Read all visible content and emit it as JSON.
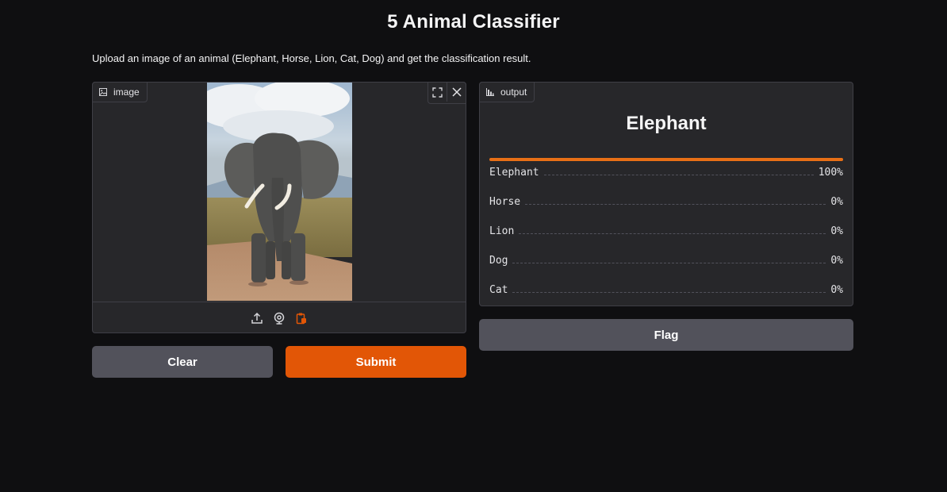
{
  "app": {
    "title": "5 Animal Classifier",
    "description": "Upload an image of an animal (Elephant, Horse, Lion, Cat, Dog) and get the classification result."
  },
  "input": {
    "label": "image",
    "label_icon": "image-icon",
    "top_tools": [
      "fullscreen-icon",
      "close-icon"
    ],
    "sources": [
      "upload-icon",
      "webcam-icon",
      "clipboard-icon"
    ]
  },
  "output": {
    "label": "output",
    "label_icon": "bar-chart-icon",
    "top_label": "Elephant",
    "confidences": [
      {
        "label": "Elephant",
        "value": "100%",
        "fraction": 1.0
      },
      {
        "label": "Horse",
        "value": "0%",
        "fraction": 0
      },
      {
        "label": "Lion",
        "value": "0%",
        "fraction": 0
      },
      {
        "label": "Dog",
        "value": "0%",
        "fraction": 0
      },
      {
        "label": "Cat",
        "value": "0%",
        "fraction": 0
      }
    ]
  },
  "buttons": {
    "clear": "Clear",
    "submit": "Submit",
    "flag": "Flag"
  },
  "colors": {
    "accent": "#e25606",
    "bar": "#e86f16",
    "panel": "#27272a",
    "background": "#0f0f11"
  }
}
